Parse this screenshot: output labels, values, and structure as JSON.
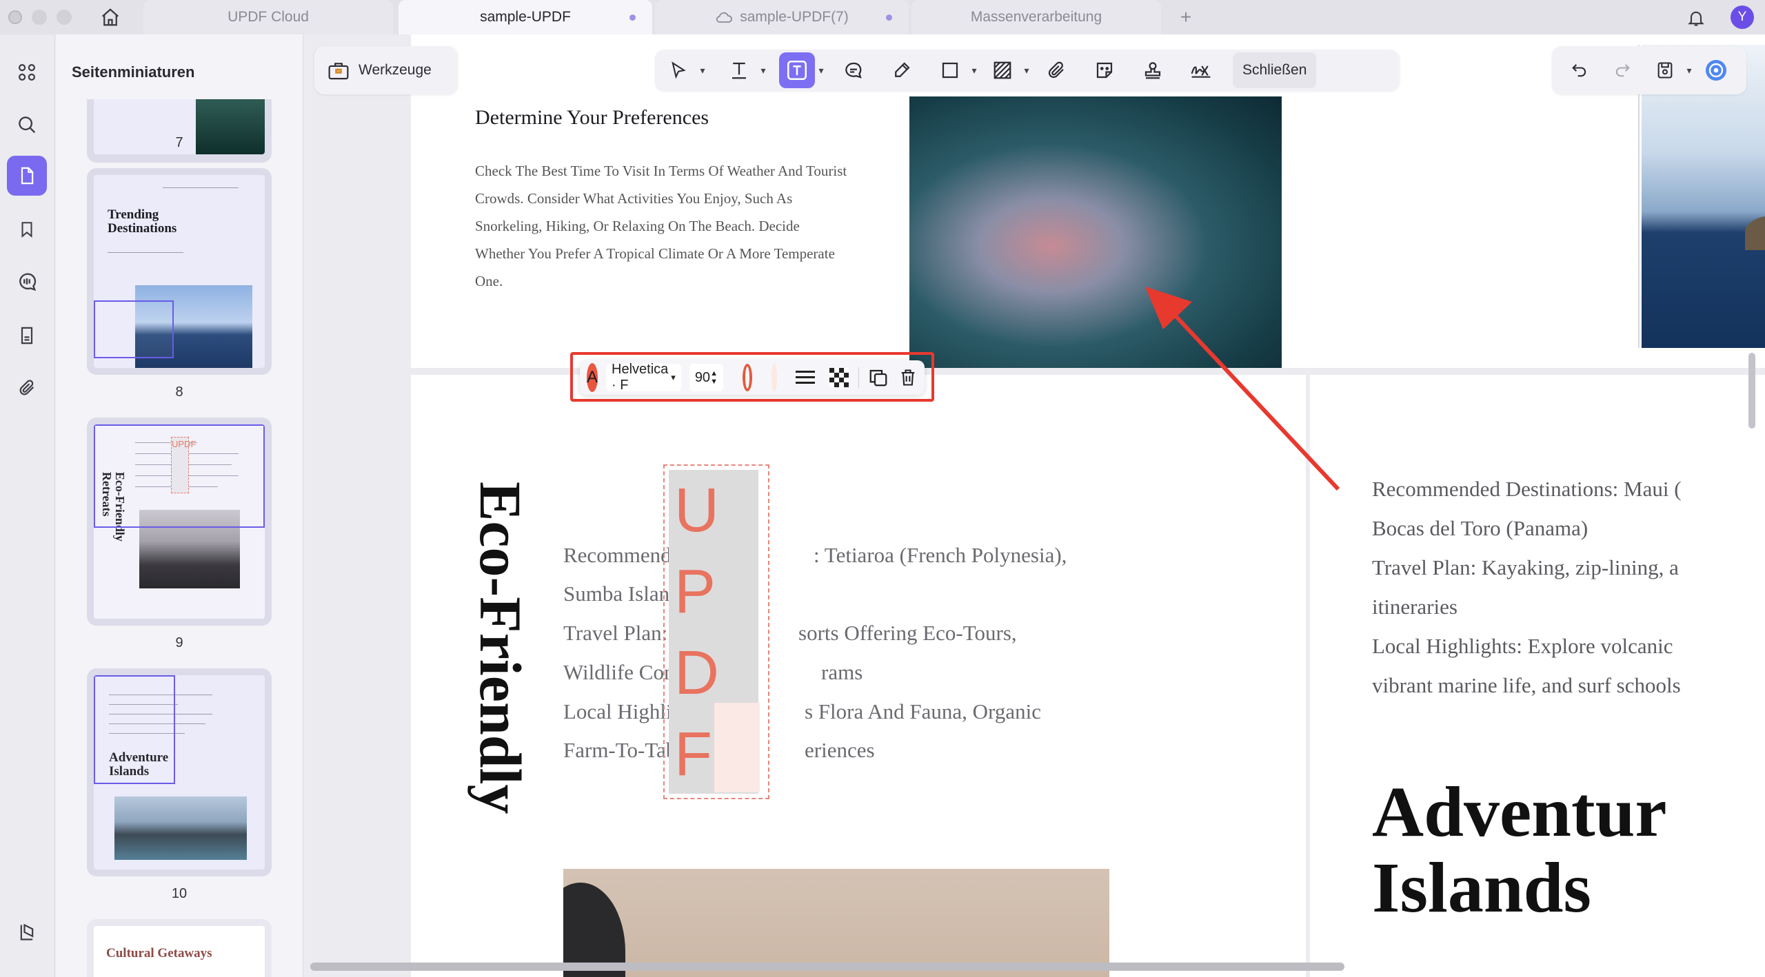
{
  "tabs": {
    "cloud": "UPDF Cloud",
    "doc1": "sample-UPDF",
    "doc2": "sample-UPDF(7)",
    "batch": "Massenverarbeitung",
    "new_tab": "+"
  },
  "user": {
    "avatar_initial": "Y"
  },
  "sidebar": {
    "title": "Seitenminiaturen"
  },
  "thumbnails": [
    {
      "page": "7"
    },
    {
      "page": "8",
      "title": "Trending Destinations"
    },
    {
      "page": "9",
      "title": "Eco-Friendly Retreats",
      "stamp": "UPDF"
    },
    {
      "page": "10",
      "title": "Adventure Islands"
    },
    {
      "page": "",
      "title": "Cultural Getaways"
    }
  ],
  "toolbar": {
    "tools_label": "Werkzeuge",
    "close_label": "Schließen"
  },
  "page_top": {
    "heading": "Determine Your Preferences",
    "body": "Check The Best Time To Visit In Terms Of Weather And Tourist Crowds. Consider What Activities You Enjoy, Such As Snorkeling, Hiking, Or Relaxing On The Beach. Decide Whether You Prefer A Tropical Climate Or A More Temperate One."
  },
  "text_box_toolbar": {
    "font_glyph": "A",
    "font_name": "Helvetica · F",
    "font_size": "90",
    "colors": {
      "text": "#e8573f",
      "border": "#e25b3b",
      "fill": "#fbe9e2"
    }
  },
  "stamp": {
    "letters": [
      "U",
      "P",
      "D",
      "F"
    ],
    "color": "#e8735f"
  },
  "page_eco": {
    "vertical_title": "Eco-Friendly",
    "lines": [
      "Recommended De",
      ": Tetiaroa (French Polynesia),",
      "Sumba Island (Ind",
      "Travel Plan: Susta",
      "sorts Offering Eco-Tours,",
      "Wildlife Conserva",
      "rams",
      "Local Highlights:",
      "s Flora And Fauna, Organic",
      "Farm-To-Table Di",
      "eriences"
    ]
  },
  "page_adventure": {
    "lines": [
      "Recommended Destinations: Maui (",
      "Bocas del Toro (Panama)",
      "Travel Plan: Kayaking, zip-lining, a",
      "itineraries",
      "Local Highlights: Explore volcanic",
      "vibrant marine life, and surf schools"
    ],
    "title_line1": "Adventur",
    "title_line2": "Islands"
  }
}
